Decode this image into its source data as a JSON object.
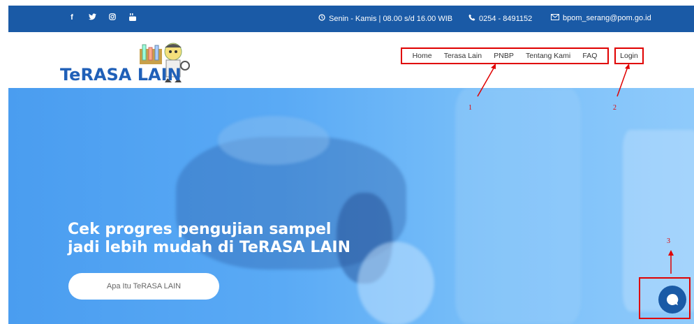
{
  "topbar": {
    "social": [
      {
        "icon": "facebook-icon",
        "glyph": "f"
      },
      {
        "icon": "twitter-icon",
        "glyph": "🐦"
      },
      {
        "icon": "instagram-icon",
        "glyph": "◎"
      },
      {
        "icon": "youtube-icon",
        "glyph": "▶"
      }
    ],
    "hours": "Senin - Kamis | 08.00 s/d 16.00 WIB",
    "phone": "0254 - 8491152",
    "email": "bpom_serang@pom.go.id"
  },
  "logo": {
    "text": "TeRASA LAIN"
  },
  "nav": {
    "items": [
      "Home",
      "Terasa Lain",
      "PNBP",
      "Tentang Kami",
      "FAQ"
    ],
    "login": "Login"
  },
  "hero": {
    "headline_line1": "Cek progres pengujian sampel",
    "headline_line2": "jadi lebih mudah di TeRASA LAIN",
    "cta": "Apa Itu TeRASA LAIN"
  },
  "annotations": [
    "1",
    "2",
    "3"
  ],
  "colors": {
    "brand": "#1a5aa6",
    "highlight": "#e00000"
  }
}
